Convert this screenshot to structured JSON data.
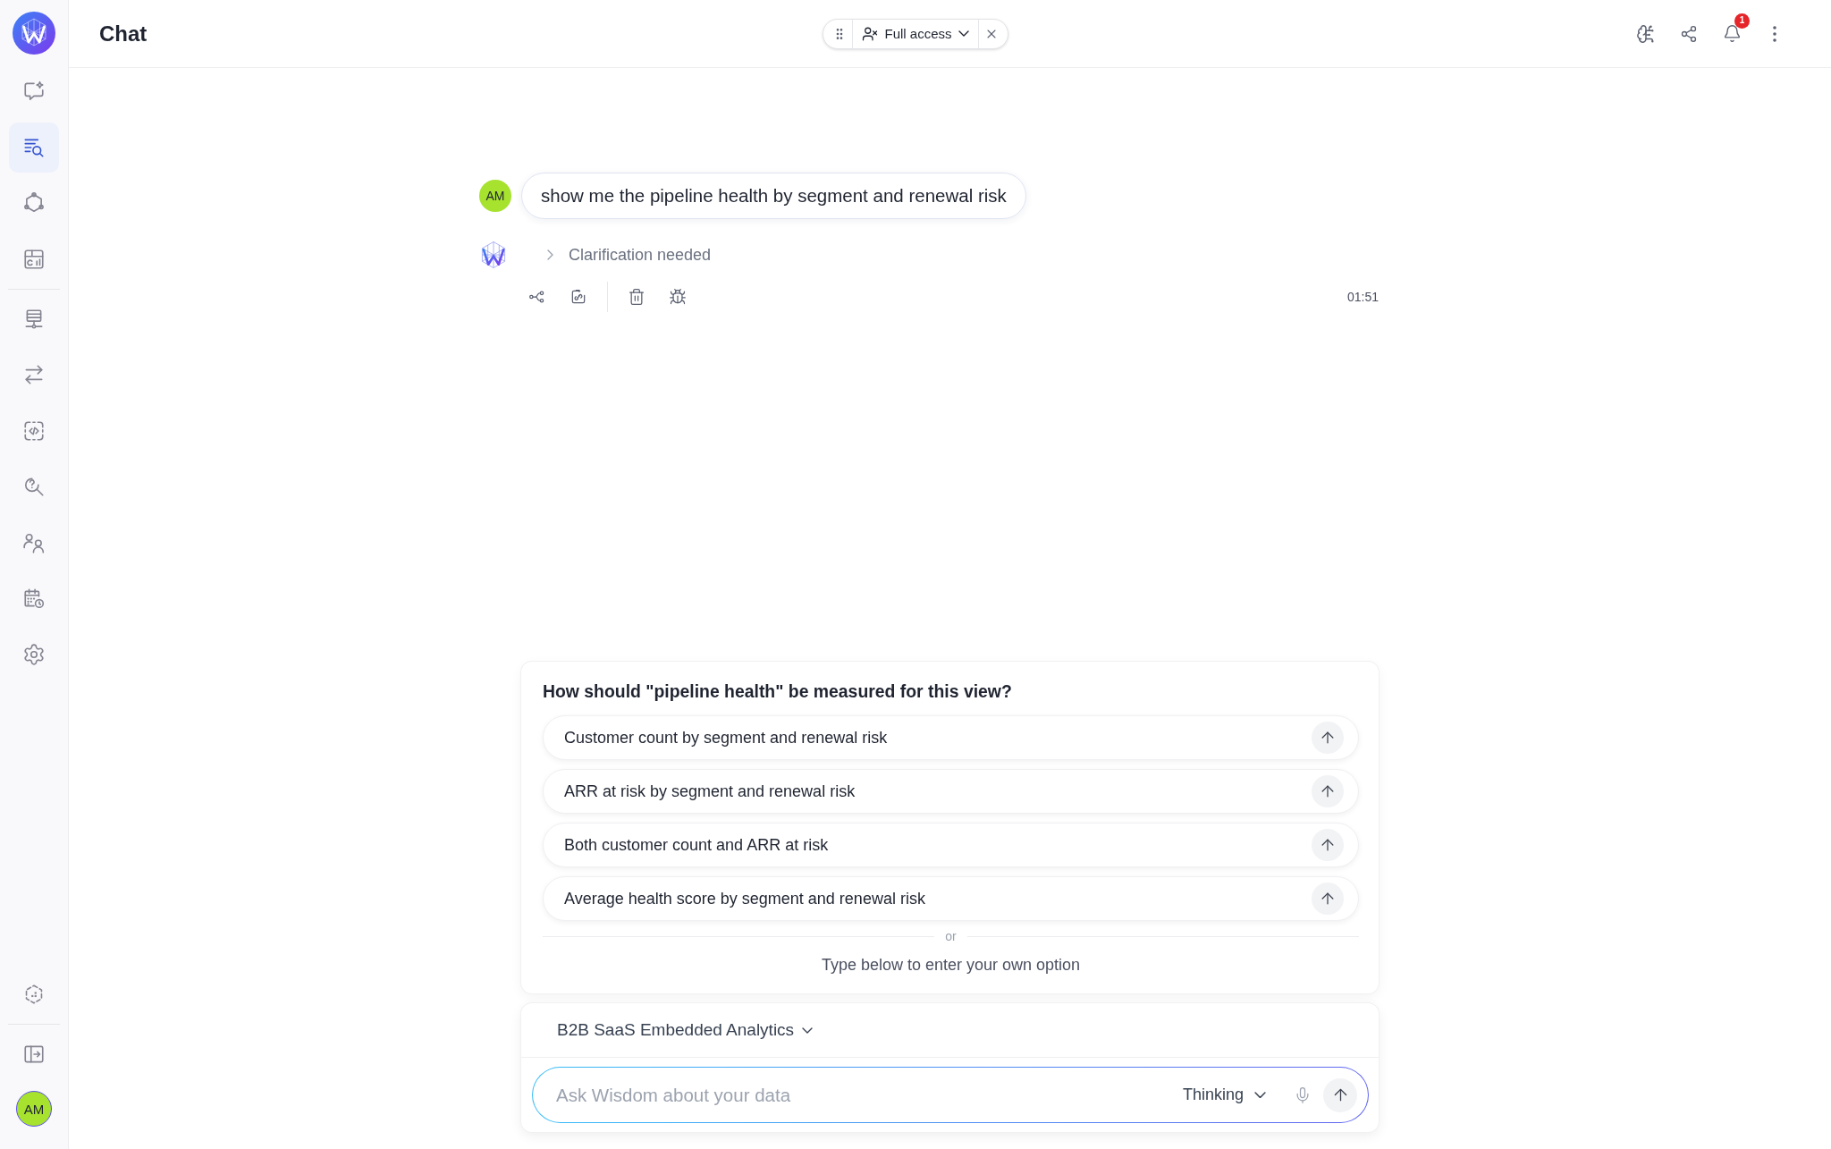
{
  "sidebar": {
    "groups": [
      {
        "items": [
          {
            "selected": false
          },
          {
            "selected": true
          },
          {
            "selected": false
          },
          {
            "selected": false
          }
        ]
      },
      {
        "items": [
          {
            "selected": false
          },
          {
            "selected": false
          },
          {
            "selected": false
          },
          {
            "selected": false
          },
          {
            "selected": false
          },
          {
            "selected": false
          },
          {
            "selected": false
          }
        ]
      }
    ],
    "user": {
      "initials": "AM"
    }
  },
  "top_bar": {
    "title": "Chat",
    "access": {
      "label": "Full access"
    },
    "notifications": {
      "count": "1"
    }
  },
  "messages": [
    {
      "kind": "user",
      "initials": "AM",
      "text": "show me the pipeline health by segment and renewal risk"
    },
    {
      "kind": "assistant",
      "status": "Clarification needed",
      "expanded": false,
      "time": "01:51"
    }
  ],
  "clarification": {
    "question": "How should \"pipeline health\" be measured for this view?",
    "options": [
      {
        "label": "Customer count by segment and renewal risk"
      },
      {
        "label": "ARR at risk by segment and renewal risk"
      },
      {
        "label": "Both customer count and ARR at risk"
      },
      {
        "label": "Average health score by segment and renewal risk"
      }
    ],
    "separator": "or",
    "hint": "Type below to enter your own option"
  },
  "composer": {
    "dataset": "B2B SaaS Embedded Analytics",
    "placeholder": "Ask Wisdom about your data",
    "mode": "Thinking"
  }
}
